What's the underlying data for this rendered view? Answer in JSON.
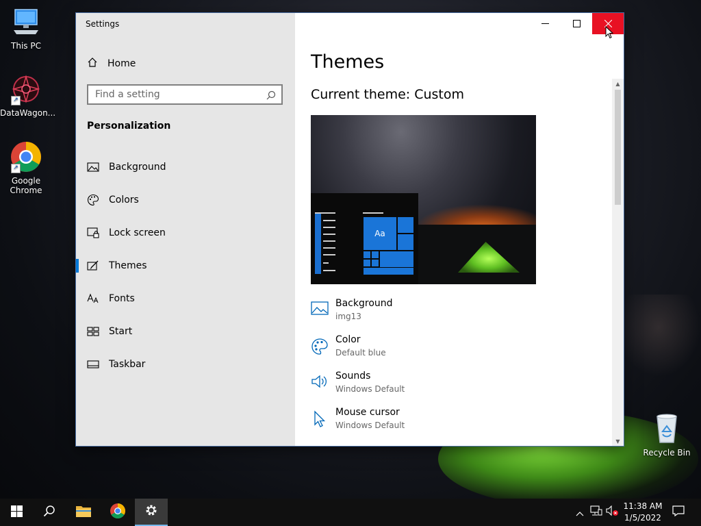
{
  "desktop": {
    "icons": [
      {
        "label": "This PC",
        "icon": "this-pc-icon"
      },
      {
        "label": "DataWagon...",
        "icon": "datawagon-icon"
      },
      {
        "label": "Google Chrome",
        "icon": "chrome-icon"
      },
      {
        "label": "Recycle Bin",
        "icon": "recycle-bin-icon"
      }
    ]
  },
  "window": {
    "title": "Settings",
    "controls": {
      "minimize": "minimize-icon",
      "maximize": "maximize-icon",
      "close": "close-icon"
    },
    "close_color": "#e81123"
  },
  "sidebar": {
    "home_label": "Home",
    "search_placeholder": "Find a setting",
    "section_title": "Personalization",
    "items": [
      {
        "label": "Background",
        "icon": "picture-icon"
      },
      {
        "label": "Colors",
        "icon": "palette-icon"
      },
      {
        "label": "Lock screen",
        "icon": "lock-screen-icon"
      },
      {
        "label": "Themes",
        "icon": "themes-icon",
        "active": true
      },
      {
        "label": "Fonts",
        "icon": "fonts-icon"
      },
      {
        "label": "Start",
        "icon": "start-icon"
      },
      {
        "label": "Taskbar",
        "icon": "taskbar-icon"
      }
    ],
    "accent_color": "#0078d7"
  },
  "main": {
    "heading": "Themes",
    "current_theme": "Current theme: Custom",
    "preview": {
      "tile_label": "Aa",
      "tile_color": "#1a75d8"
    },
    "properties": [
      {
        "label": "Background",
        "value": "img13",
        "icon": "picture-icon"
      },
      {
        "label": "Color",
        "value": "Default blue",
        "icon": "palette-icon"
      },
      {
        "label": "Sounds",
        "value": "Windows Default",
        "icon": "speaker-icon"
      },
      {
        "label": "Mouse cursor",
        "value": "Windows Default",
        "icon": "cursor-icon"
      }
    ]
  },
  "taskbar": {
    "buttons": [
      {
        "name": "start",
        "icon": "windows-logo-icon"
      },
      {
        "name": "search",
        "icon": "search-icon"
      },
      {
        "name": "file-explorer",
        "icon": "folder-icon"
      },
      {
        "name": "chrome",
        "icon": "chrome-icon"
      },
      {
        "name": "settings",
        "icon": "gear-icon",
        "active": true
      }
    ],
    "tray": {
      "time": "11:38 AM",
      "date": "1/5/2022",
      "icons": [
        "chevron-up-icon",
        "network-icon",
        "volume-muted-icon",
        "notification-icon"
      ]
    }
  }
}
